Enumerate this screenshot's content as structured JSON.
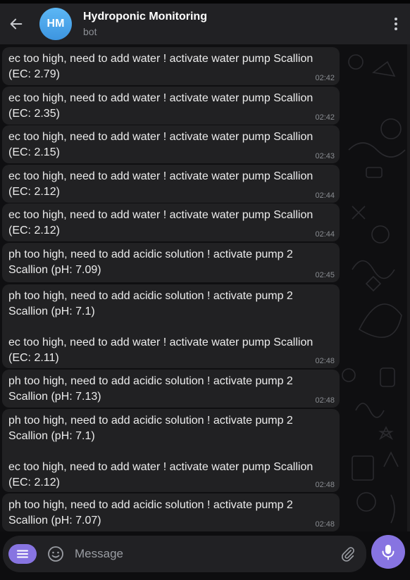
{
  "header": {
    "avatar_initials": "HM",
    "title": "Hydroponic Monitoring",
    "subtitle": "bot"
  },
  "messages": [
    {
      "lines": [
        "ec too high, need to add water ! activate water pump Scallion",
        "(EC: 2.79)"
      ],
      "time": "02:42"
    },
    {
      "lines": [
        "ec too high, need to add water ! activate water pump Scallion",
        "(EC: 2.35)"
      ],
      "time": "02:42"
    },
    {
      "lines": [
        "ec too high, need to add water ! activate water pump Scallion",
        "(EC: 2.15)"
      ],
      "time": "02:43"
    },
    {
      "lines": [
        "ec too high, need to add water ! activate water pump Scallion",
        "(EC: 2.12)"
      ],
      "time": "02:44"
    },
    {
      "lines": [
        "ec too high, need to add water ! activate water pump Scallion",
        "(EC: 2.12)"
      ],
      "time": "02:44"
    },
    {
      "lines": [
        "ph too high, need to add acidic solution ! activate pump 2",
        "Scallion (pH: 7.09)"
      ],
      "time": "02:45"
    },
    {
      "lines": [
        "ph too high, need to add acidic solution ! activate pump 2",
        "Scallion (pH: 7.1)",
        "",
        "ec too high, need to add water ! activate water pump Scallion",
        "(EC: 2.11)"
      ],
      "time": "02:48"
    },
    {
      "lines": [
        "ph too high, need to add acidic solution ! activate pump 2",
        "Scallion (pH: 7.13)"
      ],
      "time": "02:48"
    },
    {
      "lines": [
        "ph too high, need to add acidic solution ! activate pump 2",
        "Scallion (pH: 7.1)",
        "",
        "ec too high, need to add water ! activate water pump Scallion",
        "(EC: 2.12)"
      ],
      "time": "02:48"
    },
    {
      "lines": [
        "ph too high, need to add acidic solution ! activate pump 2",
        "Scallion (pH: 7.07)"
      ],
      "time": "02:48"
    }
  ],
  "composer": {
    "placeholder": "Message"
  },
  "icons": {
    "back": "back-arrow-icon",
    "menu": "more-vertical-icon",
    "bot_menu": "bot-menu-icon",
    "emoji": "emoji-icon",
    "attach": "paperclip-icon",
    "mic": "microphone-icon"
  },
  "colors": {
    "accent": "#8774e1",
    "avatar": "#4aa6ee",
    "bubble": "#212123",
    "header": "#212124",
    "time": "#8a8d92"
  }
}
